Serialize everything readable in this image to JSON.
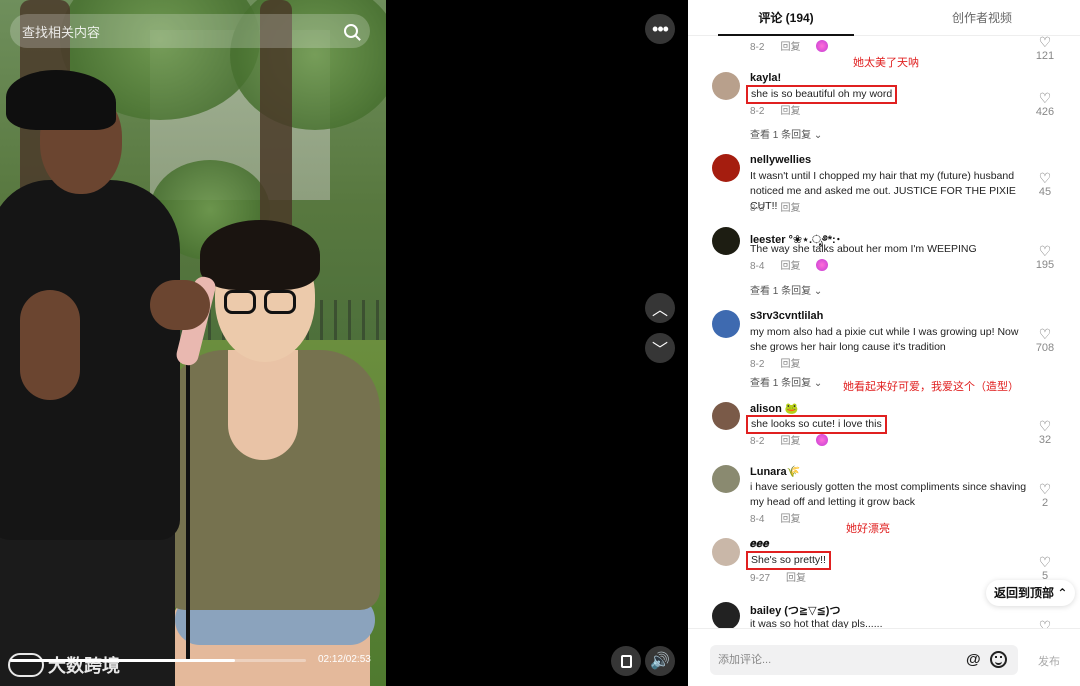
{
  "video": {
    "search_placeholder": "查找相关内容",
    "time": "02:12/02:53",
    "progress_fraction": 0.76,
    "watermark": "大数跨境",
    "more_icon": "more-dots-icon",
    "up_icon": "chevron-up-icon",
    "down_icon": "chevron-down-icon"
  },
  "tabs": [
    {
      "label": "评论 (194)"
    },
    {
      "label": "创作者视频"
    }
  ],
  "comments": [
    {
      "name": "",
      "text": "",
      "date": "8-2",
      "reply": "回复",
      "likes": "121"
    },
    {
      "name": "kayla!",
      "text": "she is so beautiful oh my word",
      "date": "8-2",
      "reply": "回复",
      "likes": "426",
      "view_replies": "查看 1 条回复"
    },
    {
      "name": "nellywellies",
      "text": "It wasn't until I chopped my hair that my (future) husband noticed me and asked me out. JUSTICE FOR THE PIXIE CUT!!",
      "date": "8-3",
      "reply": "回复",
      "likes": "45"
    },
    {
      "name": "leester °❀⋆.ೃ࿔*:･",
      "text": "The way she talks about her mom I'm WEEPING",
      "date": "8-4",
      "reply": "回复",
      "likes": "195",
      "view_replies": "查看 1 条回复"
    },
    {
      "name": "s3rv3cvntlilah",
      "text": "my mom also had a pixie cut while I was growing up! Now she grows her hair long cause it's tradition",
      "date": "8-2",
      "reply": "回复",
      "likes": "708",
      "view_replies": "查看 1 条回复"
    },
    {
      "name": "alison 🐸",
      "text": "she looks so cute! i love this",
      "date": "8-2",
      "reply": "回复",
      "likes": "32"
    },
    {
      "name": "Lunara🌾",
      "text": "i have seriously gotten the most compliments since shaving my head off and letting it grow back",
      "date": "8-4",
      "reply": "回复",
      "likes": "2"
    },
    {
      "name": "𝒆𝒆𝒆",
      "text": "She's so pretty!!",
      "date": "9-27",
      "reply": "回复",
      "likes": "5"
    },
    {
      "name": "bailey (つ≧▽≦)つ",
      "text": "it was so hot that day pls......",
      "date": "",
      "reply": "",
      "likes": ""
    }
  ],
  "translations": {
    "t1": "她太美了天呐",
    "t2": "她看起来好可爱，我爱这个（造型）",
    "t3": "她好漂亮"
  },
  "back_to_top": "返回到顶部 ⌃",
  "composer": {
    "placeholder": "添加评论...",
    "at_icon": "@",
    "post_label": "发布"
  }
}
